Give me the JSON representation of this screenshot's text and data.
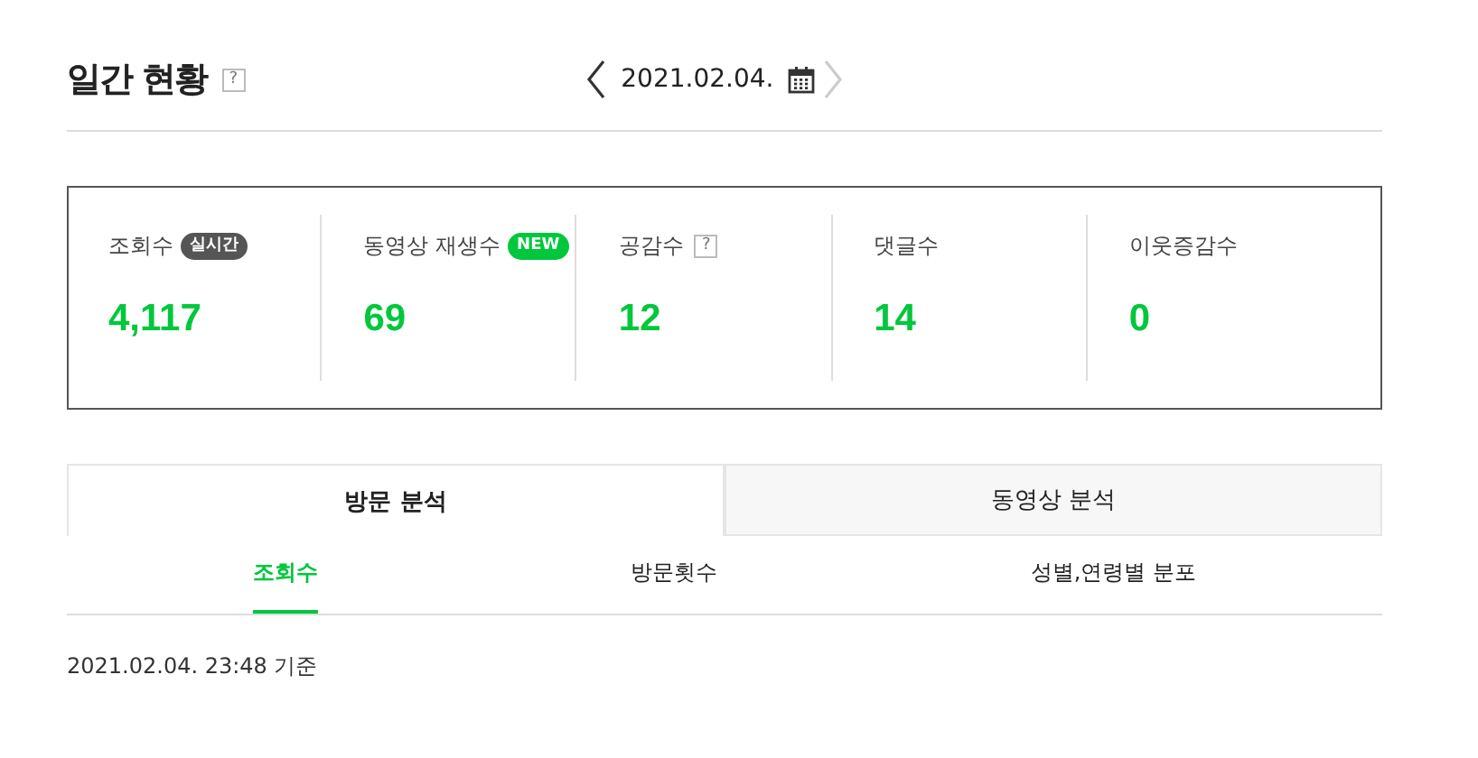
{
  "header": {
    "title": "일간 현황",
    "help": "?",
    "date": "2021.02.04.",
    "prev_disabled": false,
    "next_disabled": true
  },
  "stats": [
    {
      "label": "조회수",
      "value": "4,117",
      "badge": {
        "kind": "dark",
        "text": "실시간"
      }
    },
    {
      "label": "동영상 재생수",
      "value": "69",
      "badge": {
        "kind": "green",
        "text": "NEW"
      }
    },
    {
      "label": "공감수",
      "value": "12",
      "badge": {
        "kind": "help",
        "text": "?"
      }
    },
    {
      "label": "댓글수",
      "value": "14"
    },
    {
      "label": "이웃증감수",
      "value": "0"
    }
  ],
  "tabs": [
    {
      "label": "방문 분석",
      "selected": true
    },
    {
      "label": "동영상 분석",
      "selected": false
    }
  ],
  "subtabs": [
    {
      "label": "조회수",
      "selected": true
    },
    {
      "label": "방문횟수",
      "selected": false
    },
    {
      "label": "성별,연령별 분포",
      "selected": false
    }
  ],
  "timestamp": "2021.02.04. 23:48 기준"
}
